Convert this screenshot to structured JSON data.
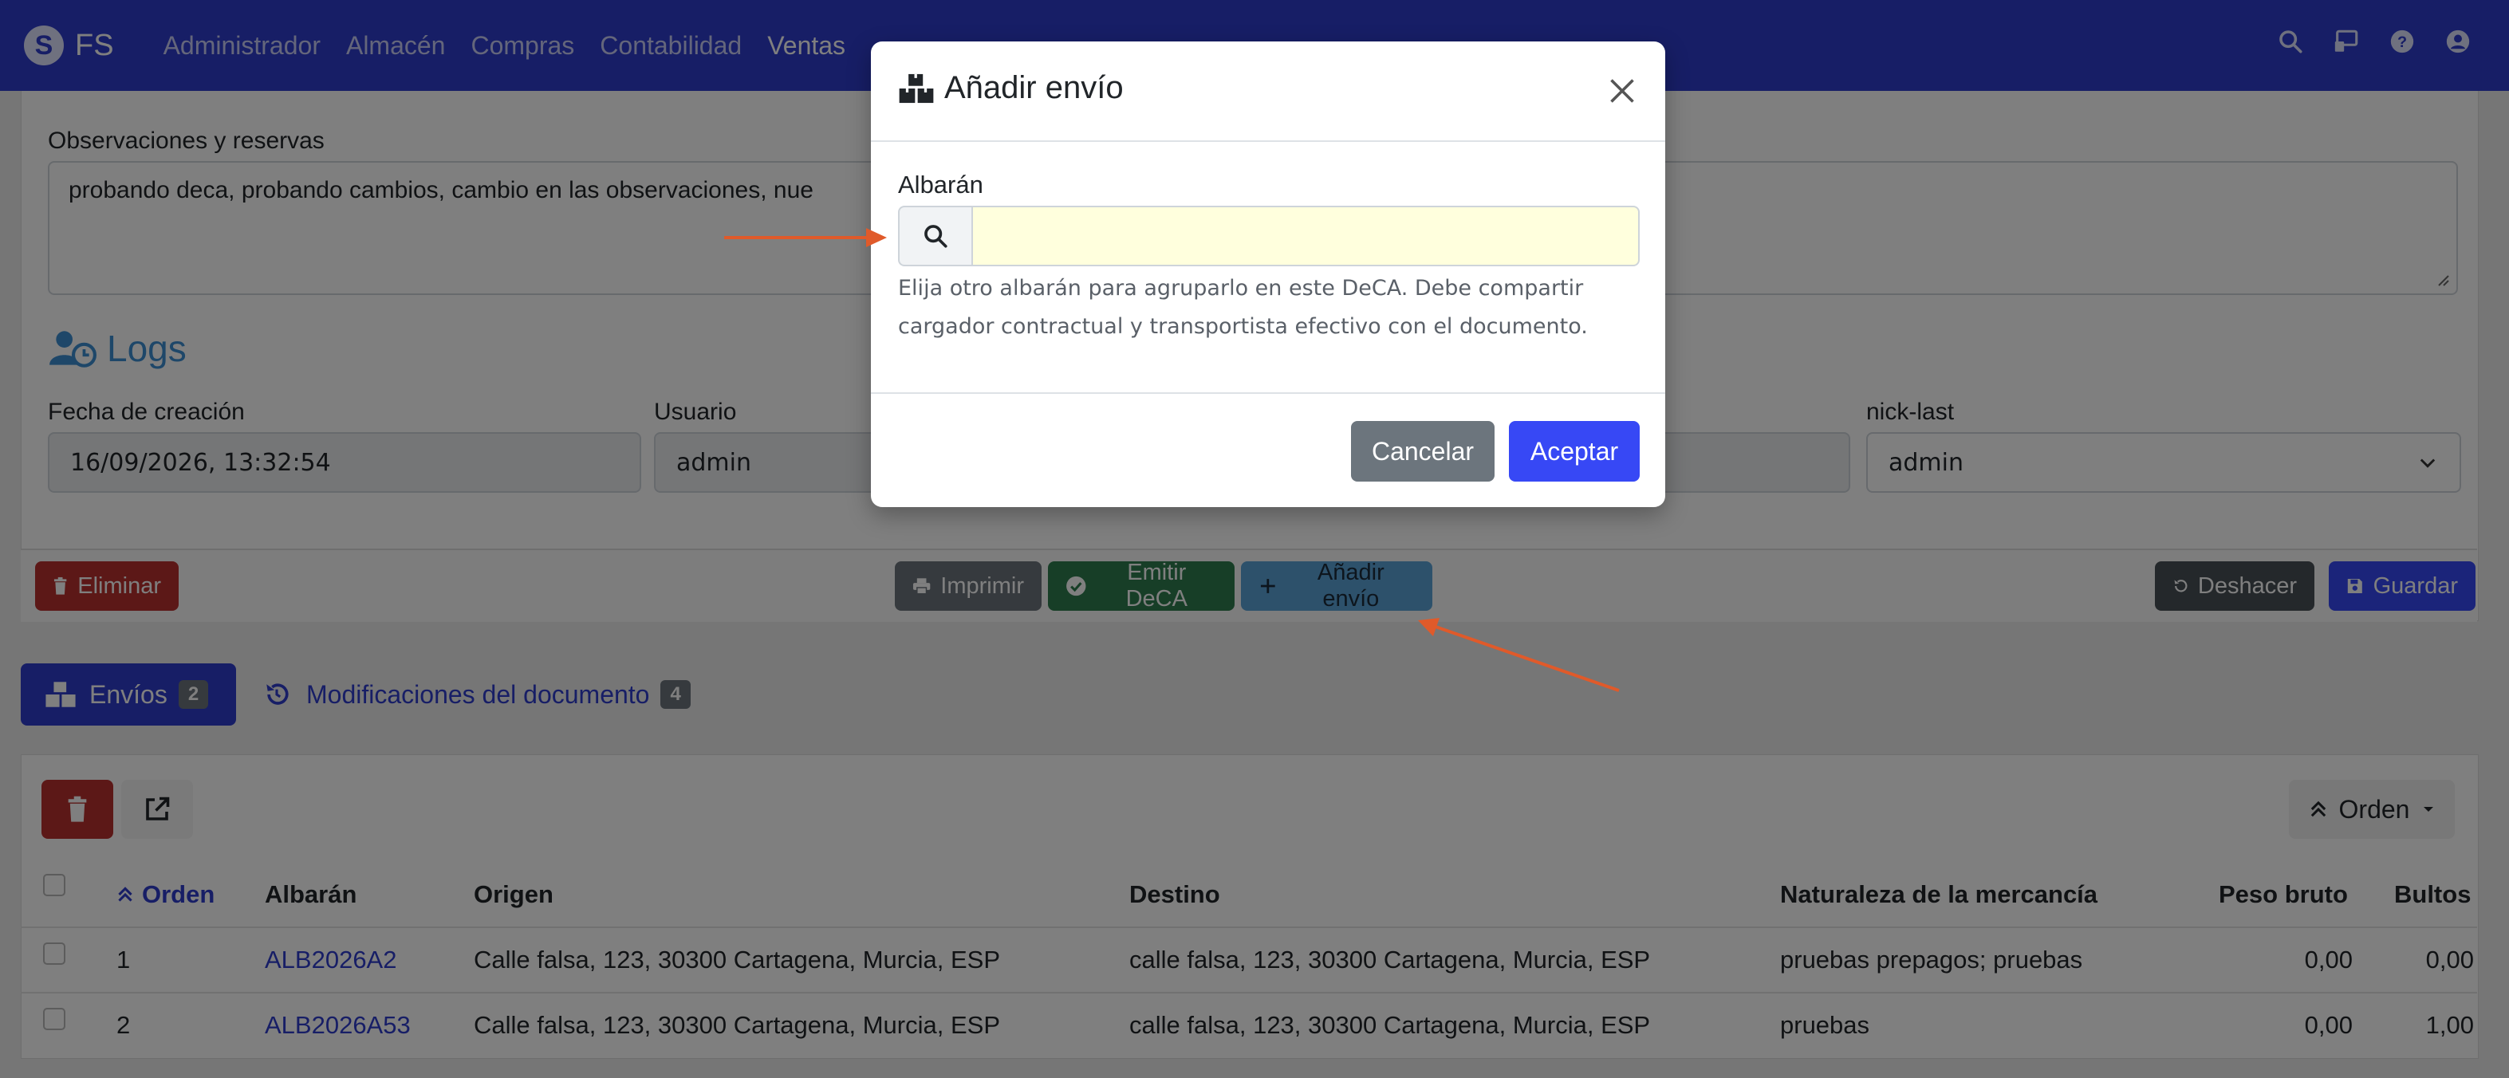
{
  "navbar": {
    "brand": "FS",
    "items": [
      "Administrador",
      "Almacén",
      "Compras",
      "Contabilidad",
      "Ventas"
    ],
    "active": "Ventas",
    "icons": [
      "search-icon",
      "screen-icon",
      "help-icon",
      "user-icon"
    ]
  },
  "form": {
    "observations_label": "Observaciones y reservas",
    "observations_value": "probando deca, probando cambios, cambio en las observaciones, nue",
    "logs_title": "Logs",
    "creation_date_label": "Fecha de creación",
    "creation_date_value": "16/09/2026, 13:32:54",
    "user_label": "Usuario",
    "user_value": "admin",
    "nick_last_label": "nick-last",
    "nick_last_value": "admin"
  },
  "toolbar": {
    "delete": "Eliminar",
    "print": "Imprimir",
    "emit": "Emitir DeCA",
    "add_shipment": "Añadir envío",
    "undo": "Deshacer",
    "save": "Guardar"
  },
  "tabs": {
    "shipments_label": "Envíos",
    "shipments_count": "2",
    "modifications_label": "Modificaciones del documento",
    "modifications_count": "4"
  },
  "table": {
    "order_button": "Orden",
    "columns": [
      "Orden",
      "Albarán",
      "Origen",
      "Destino",
      "Naturaleza de la mercancía",
      "Peso bruto",
      "Bultos"
    ],
    "rows": [
      {
        "orden": "1",
        "albaran": "ALB2026A2",
        "origen": "Calle falsa, 123, 30300 Cartagena, Murcia, ESP",
        "destino": "calle falsa, 123, 30300 Cartagena, Murcia, ESP",
        "naturaleza": "pruebas prepagos; pruebas",
        "peso": "0,00",
        "bultos": "0,00"
      },
      {
        "orden": "2",
        "albaran": "ALB2026A53",
        "origen": "Calle falsa, 123, 30300 Cartagena, Murcia, ESP",
        "destino": "calle falsa, 123, 30300 Cartagena, Murcia, ESP",
        "naturaleza": "pruebas",
        "peso": "0,00",
        "bultos": "1,00"
      }
    ]
  },
  "modal": {
    "title": "Añadir envío",
    "field_label": "Albarán",
    "field_value": "",
    "help_text": "Elija otro albarán para agruparlo en este DeCA. Debe compartir cargador contractual y transportista efectivo con el documento.",
    "cancel": "Cancelar",
    "accept": "Aceptar"
  },
  "colors": {
    "navbar": "#2f3ccc",
    "danger": "#b8312f",
    "secondary": "#6c757d",
    "success": "#2e7d4f",
    "info": "#5aa3d6",
    "dark": "#495057",
    "primary": "#3748f5",
    "input_highlight": "#ffffdd",
    "arrow": "#e05a2a"
  }
}
